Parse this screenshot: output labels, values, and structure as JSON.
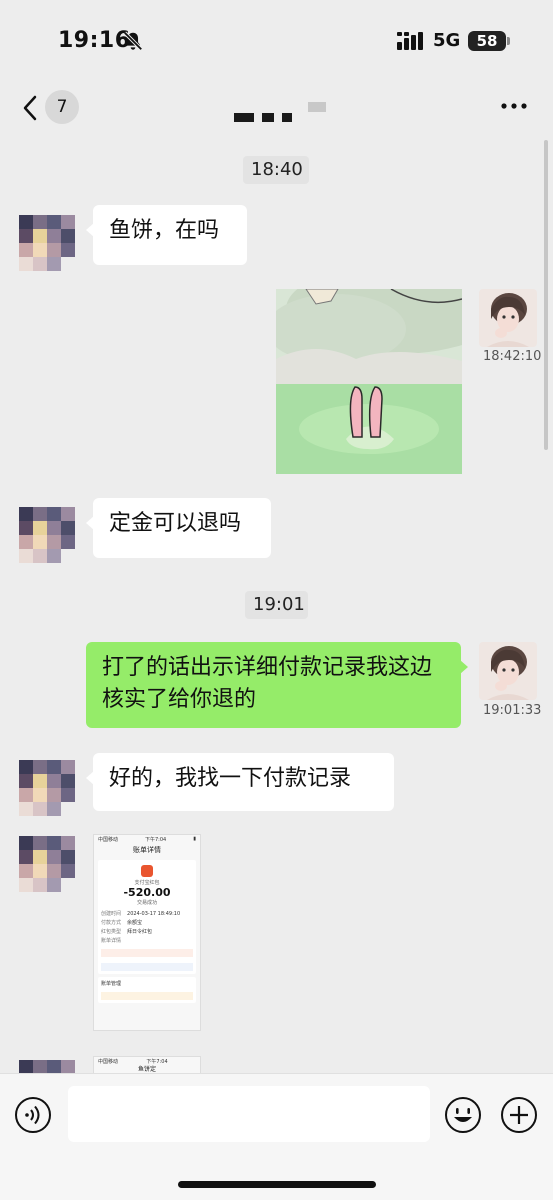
{
  "status_bar": {
    "time": "19:16",
    "network": "5G",
    "battery": "58"
  },
  "nav": {
    "unread_count": "7"
  },
  "messages": {
    "ts1": "18:40",
    "m1": "鱼饼，在吗",
    "sticker_time": "18:42:10",
    "m2": "定金可以退吗",
    "ts2": "19:01",
    "m3": "打了的话出示详细付款记录我这边核实了给你退的",
    "m3_time": "19:01:33",
    "m4": "好的，我找一下付款记录"
  },
  "shot1": {
    "carrier": "中国移动",
    "clock": "下午7:04",
    "title": "账单详情",
    "payee": "支付宝红包",
    "amount": "-520.00",
    "status": "交易成功",
    "rows": [
      {
        "k": "创建时间",
        "v": "2024-03-17 18:49:10"
      },
      {
        "k": "付款方式",
        "v": "余额宝"
      },
      {
        "k": "红包类型",
        "v": "拜日令红包"
      },
      {
        "k": "账单详情",
        "v": ""
      }
    ],
    "section": "账单管理"
  },
  "shot2": {
    "carrier": "中国移动",
    "clock": "下午7:04",
    "title": "鱼饼定"
  },
  "icons": {
    "back": "chevron-left-icon",
    "more": "more-dots-icon",
    "voice": "voice-icon",
    "emoji": "emoji-icon",
    "plus": "plus-icon",
    "mute": "bell-slash-icon"
  },
  "colors": {
    "outgoing_bubble": "#95ec69",
    "incoming_bubble": "#ffffff",
    "background": "#ededed"
  }
}
